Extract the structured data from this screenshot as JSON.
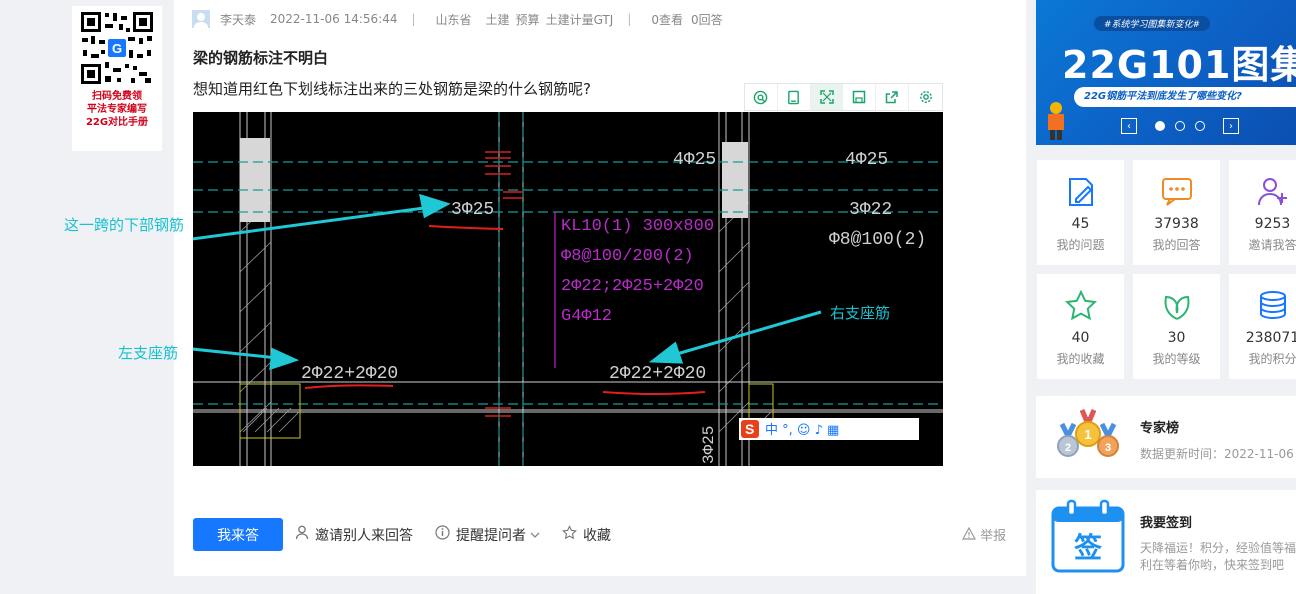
{
  "qr_card": {
    "line1": "扫码免费领",
    "line2": "平法专家编写",
    "line3": "22G对比手册"
  },
  "question": {
    "author": "李天泰",
    "time": "2022-11-06 14:56:44",
    "sep": "|",
    "province": "山东省",
    "tags": [
      "土建",
      "预算",
      "土建计量GTJ"
    ],
    "views": "0查看",
    "answers": "0回答",
    "title": "梁的钢筋标注不明白",
    "body": "想知道用红色下划线标注出来的三处钢筋是梁的什么钢筋呢?"
  },
  "image_toolbar": {
    "icons": [
      "circle-search-icon",
      "copy-icon",
      "fullscreen-icon",
      "save-icon",
      "share-icon",
      "settings-icon"
    ]
  },
  "cad_image": {
    "texts": {
      "t1": "4Φ25",
      "t2": "4Φ25",
      "t3": "3Φ25",
      "t4": "3Φ22",
      "t5": "Φ8@100(2)",
      "kl1": "KL10(1) 300x800",
      "kl2": "Φ8@100/200(2)",
      "kl3": "2Φ22;2Φ25+2Φ20",
      "kl4": "G4Φ12",
      "b1": "2Φ22+2Φ20",
      "b2": "2Φ22+2Φ20",
      "b3": "3Φ25"
    },
    "ime_bar": "中 °, ☺ ♪ ▦"
  },
  "annotations": {
    "bottom_span": "这一跨的下部钢筋",
    "left_support": "左支座筋",
    "right_support": "右支座筋"
  },
  "actions": {
    "answer": "我来答",
    "invite": "邀请别人来回答",
    "remind": "提醒提问者",
    "collect": "收藏",
    "report": "举报"
  },
  "banner": {
    "tag": "#系统学习图集新变化#",
    "title": "22G101图集",
    "subtitle": "22G钢筋平法到底发生了哪些变化?",
    "accent": "#0b78d6"
  },
  "stats": [
    {
      "icon": "edit-icon",
      "num": "45",
      "label": "我的问题",
      "color": "#1677ff"
    },
    {
      "icon": "chat-icon",
      "num": "37938",
      "label": "我的回答",
      "color": "#f08a24"
    },
    {
      "icon": "add-user-icon",
      "num": "9253",
      "label": "邀请我答",
      "color": "#8a4fd8"
    },
    {
      "icon": "star-icon",
      "num": "40",
      "label": "我的收藏",
      "color": "#2bb673"
    },
    {
      "icon": "leaf-icon",
      "num": "30",
      "label": "我的等级",
      "color": "#2bb673"
    },
    {
      "icon": "coins-icon",
      "num": "238071",
      "label": "我的积分",
      "color": "#1677ff"
    }
  ],
  "expert": {
    "title": "专家榜",
    "updated": "数据更新时间：2022-11-06"
  },
  "checkin": {
    "title": "我要签到",
    "badge": "签",
    "desc1": "天降福运！积分，经验值等福",
    "desc2": "利在等着你哟，快来签到吧"
  }
}
